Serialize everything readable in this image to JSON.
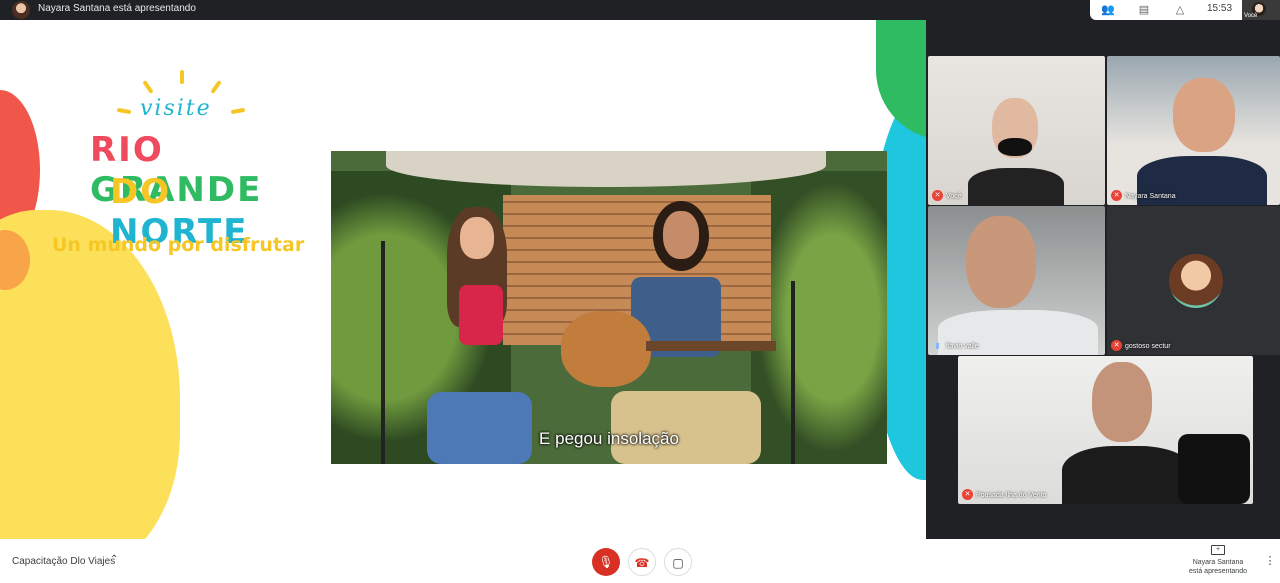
{
  "topbar": {
    "presenter_label": "Nayara Santana está apresentando",
    "time": "15:53",
    "self_label": "Você"
  },
  "slide": {
    "logo_visite": "visite",
    "logo_line2": [
      {
        "text": "RIO ",
        "color": "#ef4a5e"
      },
      {
        "text": "GRANDE",
        "color": "#2fbb62"
      }
    ],
    "logo_line3": [
      {
        "text": "DO ",
        "color": "#f6c624"
      },
      {
        "text": "NORTE",
        "color": "#1fb5d1"
      }
    ],
    "slogan": "Un mundo por disfrutar",
    "video_subtitle": "E pegou insolação"
  },
  "participants": [
    {
      "name": "Você",
      "muted": true
    },
    {
      "name": "Nayara Santana",
      "muted": true
    },
    {
      "name": "flavio valle",
      "muted": false
    },
    {
      "name": "gostoso sectur",
      "muted": true
    },
    {
      "name": "Pousada Ilha do Vento",
      "muted": true
    }
  ],
  "bottombar": {
    "meeting_name": "Capacitação Dlo Viajes",
    "presenting_line1": "Nayara Santana",
    "presenting_line2": "está apresentando"
  },
  "colors": {
    "mic_off": "#ea4335",
    "hangup": "#d93025",
    "brand_cyan": "#1fb5d1",
    "brand_yellow": "#f6c624"
  }
}
